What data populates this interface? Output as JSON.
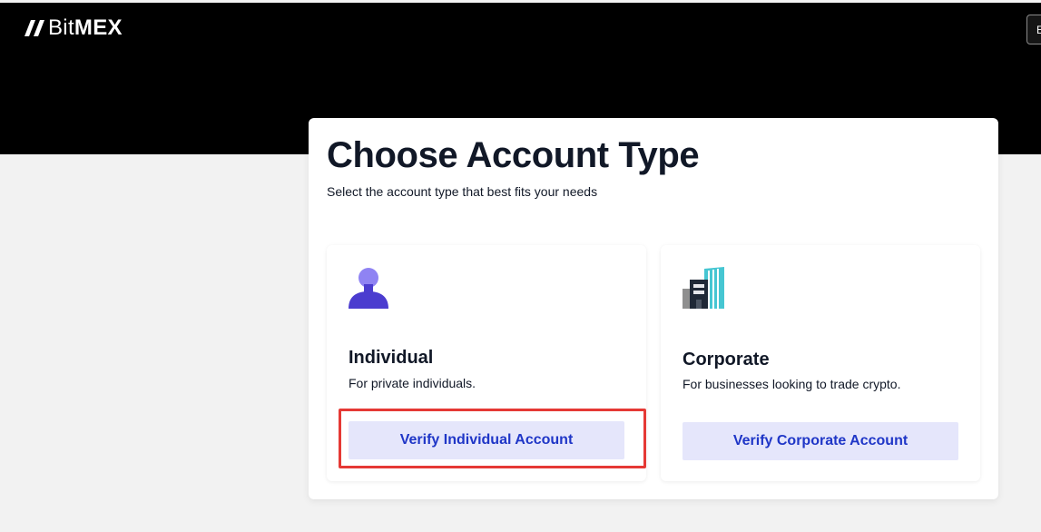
{
  "header": {
    "logo_bit": "Bit",
    "logo_mex": "MEX",
    "logo_icon": "bitmex-logo-icon",
    "button_label": "E"
  },
  "main": {
    "title": "Choose Account Type",
    "subtitle": "Select the account type that best fits your needs"
  },
  "options": [
    {
      "icon": "person-icon",
      "title": "Individual",
      "description": "For private individuals.",
      "button_label": "Verify Individual Account"
    },
    {
      "icon": "building-icon",
      "title": "Corporate",
      "description": "For businesses looking to trade crypto.",
      "button_label": "Verify Corporate Account"
    }
  ],
  "colors": {
    "header_background": "#000000",
    "page_background": "#f2f2f2",
    "button_background": "#e5e6fb",
    "button_text": "#1f36c7",
    "highlight_border": "#e53935",
    "person_icon_head": "#8f83f3",
    "person_icon_body": "#4b3ccf",
    "building_icon_teal": "#46c6d2"
  }
}
